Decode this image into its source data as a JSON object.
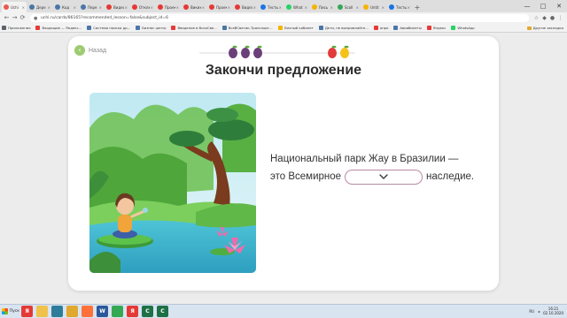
{
  "browser": {
    "tabs": [
      {
        "title": "Uchi",
        "color": "#e85a4f",
        "active": true
      },
      {
        "title": "Дере",
        "color": "#4a76a8"
      },
      {
        "title": "Код",
        "color": "#4a76a8"
      },
      {
        "title": "Пере",
        "color": "#4a76a8"
      },
      {
        "title": "Видео",
        "color": "#e53935"
      },
      {
        "title": "Отклю",
        "color": "#e53935"
      },
      {
        "title": "Проек",
        "color": "#e53935"
      },
      {
        "title": "Виких",
        "color": "#e53935"
      },
      {
        "title": "Проек",
        "color": "#e53935"
      },
      {
        "title": "Видео",
        "color": "#e53935"
      },
      {
        "title": "Тесты",
        "color": "#1a73e8"
      },
      {
        "title": "What",
        "color": "#25d366"
      },
      {
        "title": "Пись",
        "color": "#f5b400"
      },
      {
        "title": "Scoll",
        "color": "#34a853"
      },
      {
        "title": "Untit",
        "color": "#f5b400"
      },
      {
        "title": "Тесты",
        "color": "#1a73e8"
      }
    ],
    "new_tab": "+",
    "window_controls": {
      "minimize": "—",
      "maximize": "□",
      "close": "✕"
    },
    "url": "uchi.ru/cards/86165?recommended_lesson=false&subject_id=6",
    "nav": {
      "back": "←",
      "forward": "→",
      "reload": "⟳"
    },
    "bookmarks": [
      {
        "label": "Приложения",
        "color": "#5f6368"
      },
      {
        "label": "Входящие — Яндекс...",
        "color": "#e53935"
      },
      {
        "label": "Система поиска др...",
        "color": "#4a76a8"
      },
      {
        "label": "Бизнес центр",
        "color": "#4a76a8"
      },
      {
        "label": "Введение в ВсеоСве...",
        "color": "#e53935"
      },
      {
        "label": "ВсеВСветик-Транспорт...",
        "color": "#4a76a8"
      },
      {
        "label": "Личный кабинет",
        "color": "#f5b400"
      },
      {
        "label": "Дети, не выпрямляйте...",
        "color": "#4a76a8"
      },
      {
        "label": "апро",
        "color": "#e53935"
      },
      {
        "label": "Авиабилеты",
        "color": "#4a76a8"
      },
      {
        "label": "Яндекс",
        "color": "#e53935"
      },
      {
        "label": "WhatsApp",
        "color": "#25d366"
      }
    ],
    "other_bookmarks": "Другие закладки"
  },
  "lesson": {
    "back_label": "Назад",
    "title": "Закончи предложение",
    "progress": {
      "completed": 3,
      "total": 5
    },
    "sentence": {
      "line1": "Национальный парк Жау в Бразилии —",
      "before_blank": "это Всемирное",
      "after_blank": "наследие."
    },
    "answer_dropdown": {
      "selected": ""
    }
  },
  "taskbar": {
    "start_label": "Пуск",
    "apps": [
      {
        "name": "yandex-browser",
        "label": "Я",
        "color": "#e53935"
      },
      {
        "name": "explorer",
        "label": "",
        "color": "#f0c24b"
      },
      {
        "name": "media",
        "label": "",
        "color": "#2d7d9a"
      },
      {
        "name": "folder",
        "label": "",
        "color": "#e0a82e"
      },
      {
        "name": "firefox",
        "label": "",
        "color": "#ff7139"
      },
      {
        "name": "word",
        "label": "W",
        "color": "#2b579a"
      },
      {
        "name": "chrome",
        "label": "",
        "color": "#34a853"
      },
      {
        "name": "yandex",
        "label": "Я",
        "color": "#e53935"
      },
      {
        "name": "app-c",
        "label": "C",
        "color": "#1e7145"
      },
      {
        "name": "app-c2",
        "label": "C",
        "color": "#1e7145"
      }
    ],
    "language": "RU",
    "time": "16:21",
    "date": "02.10.2020"
  }
}
